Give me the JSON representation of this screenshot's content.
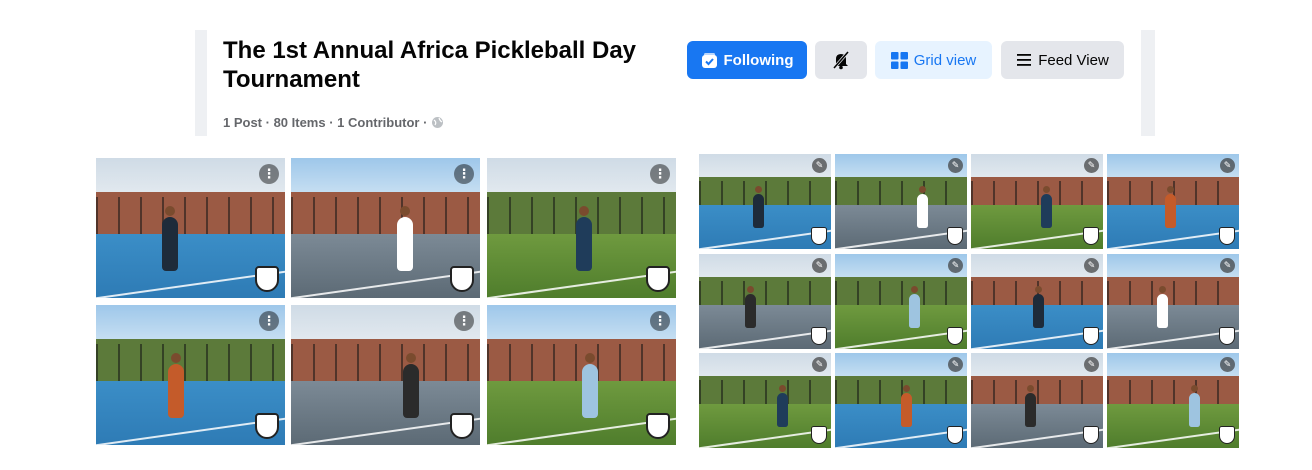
{
  "album": {
    "title": "The 1st Annual Africa Pickleball Day Tournament",
    "meta": "1 Post · 80 Items · 1 Contributor ·"
  },
  "actions": {
    "following_label": "Following",
    "grid_label": "Grid view",
    "feed_label": "Feed View"
  },
  "icons": {
    "following": "follow-check-icon",
    "mute": "bell-off-icon",
    "grid": "grid-icon",
    "feed": "list-icon",
    "privacy": "globe-icon"
  },
  "colors": {
    "primary": "#1877f2",
    "secondary_bg": "#e4e6eb",
    "grid_active_bg": "#e7f3ff",
    "meta_text": "#65676b"
  },
  "tile_glyphs": {
    "more": "⋮",
    "edit": "✎"
  }
}
